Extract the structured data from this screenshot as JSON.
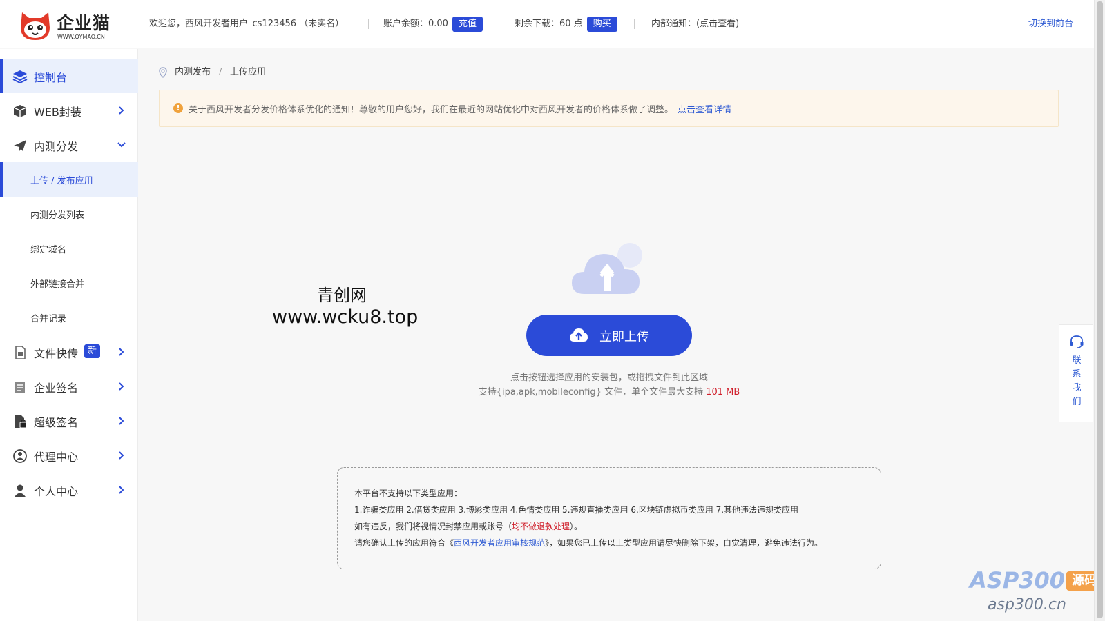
{
  "header": {
    "brand": "企业猫",
    "brand_url": "WWW.QYMAO.CN",
    "welcome": "欢迎您，西风开发者用户_cs123456 （未实名）",
    "balance_label": "账户余额：0.00",
    "recharge_label": "充值",
    "downloads_label": "剩余下载：60 点",
    "buy_label": "购买",
    "notice_label": "内部通知：(点击查看)",
    "switch_label": "切换到前台"
  },
  "sidebar": {
    "items": [
      {
        "label": "控制台",
        "icon": "layers-icon"
      },
      {
        "label": "WEB封装",
        "icon": "box-icon"
      },
      {
        "label": "内测分发",
        "icon": "paper-plane-icon"
      },
      {
        "label": "文件快传",
        "icon": "file-icon",
        "badge": "新"
      },
      {
        "label": "企业签名",
        "icon": "certificate-icon"
      },
      {
        "label": "超级签名",
        "icon": "document-lock-icon"
      },
      {
        "label": "代理中心",
        "icon": "agent-icon"
      },
      {
        "label": "个人中心",
        "icon": "user-icon"
      }
    ],
    "sub_items": [
      {
        "label": "上传 / 发布应用"
      },
      {
        "label": "内测分发列表"
      },
      {
        "label": "绑定域名"
      },
      {
        "label": "外部链接合并"
      },
      {
        "label": "合并记录"
      }
    ]
  },
  "breadcrumb": {
    "level1": "内测发布",
    "separator": "/",
    "level2": "上传应用"
  },
  "notice": {
    "text": "关于西风开发者分发价格体系优化的通知！尊敬的用户您好，我们在最近的网站优化中对西风开发者的价格体系做了调整。",
    "link": "点击查看详情"
  },
  "upload": {
    "button_label": "立即上传",
    "hint_line1": "点击按钮选择应用的安装包，或拖拽文件到此区域",
    "hint_line2_prefix": "支持{ipa,apk,mobileconfig} 文件，单个文件最大支持 ",
    "max_size": "101 MB"
  },
  "watermark": {
    "line1": "青创网",
    "line2": "www.wcku8.top"
  },
  "rules": {
    "title": "本平台不支持以下类型应用：",
    "list": "1.诈骗类应用 2.借贷类应用 3.博彩类应用 4.色情类应用 5.违规直播类应用 6.区块链虚拟币类应用 7.其他违法违规类应用",
    "violation_prefix": "如有违反，我们将视情况封禁应用或账号（",
    "violation_red": "均不做退款处理",
    "violation_suffix": "）。",
    "confirm_prefix": "请您确认上传的应用符合《",
    "confirm_link": "西风开发者应用审核规范",
    "confirm_suffix": "》，如果您已上传以上类型应用请尽快删除下架，自觉清理，避免违法行为。"
  },
  "contact": {
    "label": "联系我们"
  },
  "site_logo": {
    "text": "ASP300",
    "badge": "源码",
    "url": "asp300.cn"
  },
  "colors": {
    "primary": "#2b4bd8",
    "notice_bg": "#fdf6ec",
    "warning": "#f0a23c",
    "danger": "#d0202c"
  }
}
